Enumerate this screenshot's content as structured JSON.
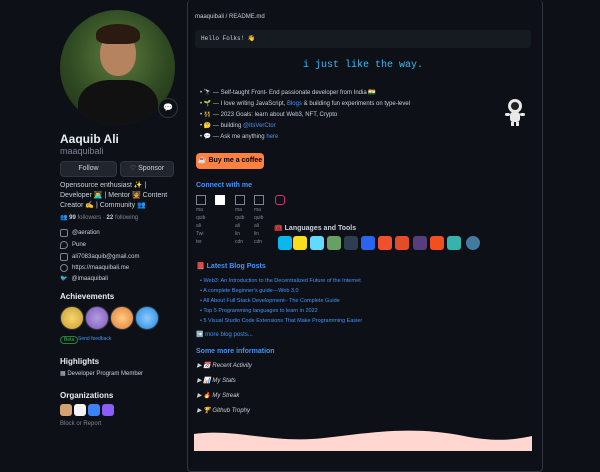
{
  "profile": {
    "name": "Aaquib Ali",
    "handle": "maaquibali",
    "follow_label": "Follow",
    "sponsor_label": "Sponsor",
    "bio": "Opensource enthusiast ✨ | Developer 👨‍💻 | Mentor 🧑‍🏫 Content Creator ✍️ | Community 👥",
    "followers": "99",
    "followers_label": "followers",
    "following": "22",
    "following_label": "following",
    "company": "@aeration",
    "location": "Pune",
    "email": "ali7083aquib@gmail.com",
    "website": "https://maaquibali.me",
    "twitter": "@imaaquibali",
    "achievements_title": "Achievements",
    "beta_label": "Beta",
    "feedback_label": "Send feedback",
    "highlights_title": "Highlights",
    "highlight_item": "Developer Program Member",
    "orgs_title": "Organizations",
    "block_label": "Block or Report"
  },
  "readme": {
    "path": "maaquibali / README.md",
    "hello": "Hello Folks! 👋",
    "typing": "i just like the way.",
    "bullets": [
      {
        "icon": "🔭",
        "text": "Self-taught Front- End passionate developer from India 🇮🇳"
      },
      {
        "icon": "🌱",
        "text": "I love writing JavaScript, ",
        "link": "Blogs",
        "text2": " & building fun experiments on type-level"
      },
      {
        "icon": "👯",
        "text": "2023 Goals: learn about Web3, NFT, Crypto"
      },
      {
        "icon": "🤔",
        "text": "building ",
        "link": "@ItsVerCtor"
      },
      {
        "icon": "💬",
        "text": "Ask me anything ",
        "link": "here"
      }
    ],
    "coffee": "☕ Buy me a coffee",
    "connect_title": "Connect with me",
    "languages_title": "🧰 Languages and Tools",
    "blog_title": "📕 Latest Blog Posts",
    "blog_posts": [
      "Web3: An Introduction to the Decentralized Future of the Internet",
      "A complete Beginner's guide—Web 3.0",
      "All About Full Stack Development– The Complete Guide",
      "Top 5 Programming languages to learn in 2022",
      "5 Visual Studio Code Extensions That Make Programming Easier"
    ],
    "more_posts": "➡️ more blog posts...",
    "more_info_title": "Some more information",
    "details": [
      "📆 Recent Activity",
      "📊 My Stats",
      "🔥 My Streak",
      "🏆 Github Trophy"
    ]
  },
  "colors": {
    "background": "#0d1117",
    "accent": "#4493f8",
    "coffee": "#ff813f",
    "wave": "#ffd6d0"
  }
}
